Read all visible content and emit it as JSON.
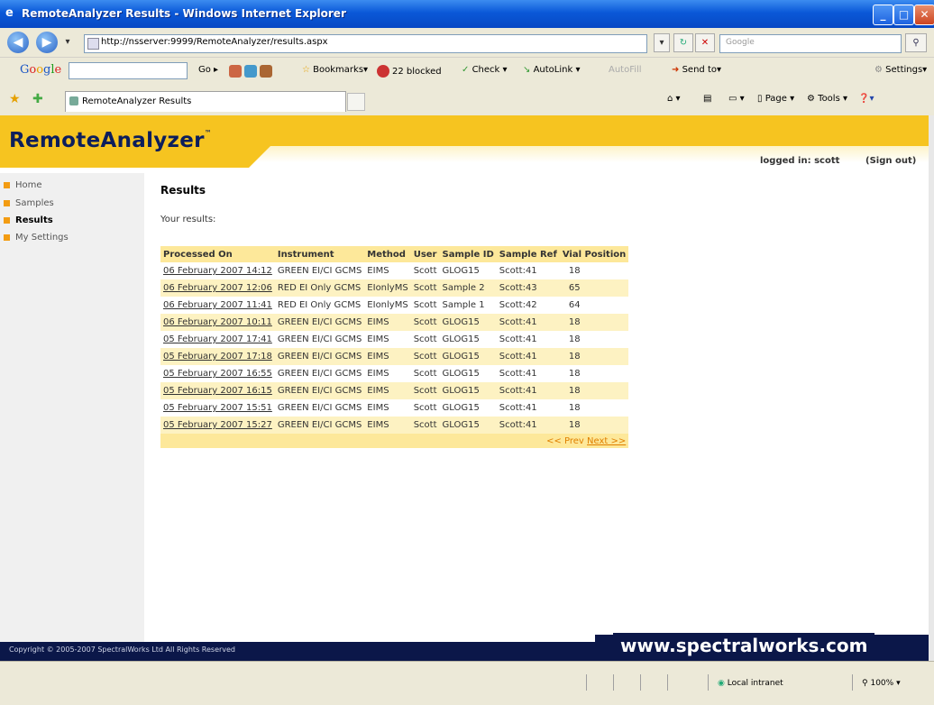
{
  "window": {
    "title": "RemoteAnalyzer Results - Windows Internet Explorer"
  },
  "address": {
    "url": "http://nsserver:9999/RemoteAnalyzer/results.aspx",
    "search_placeholder": "Google"
  },
  "gtoolbar": {
    "go": "Go",
    "bookmarks": "Bookmarks",
    "blocked": "22 blocked",
    "check": "Check",
    "autolink": "AutoLink",
    "autofill": "AutoFill",
    "sendto": "Send to",
    "settings": "Settings"
  },
  "tab": {
    "label": "RemoteAnalyzer Results"
  },
  "cmdbar": {
    "page": "Page",
    "tools": "Tools"
  },
  "site": {
    "logo": "RemoteAnalyzer",
    "tm": "™",
    "login": "logged in: scott",
    "signout": "(Sign out)",
    "nav": [
      "Home",
      "Samples",
      "Results",
      "My Settings"
    ],
    "page_title": "Results",
    "intro": "Your results:",
    "footer_copy": "Copyright © 2005-2007 SpectralWorks Ltd  All Rights Reserved",
    "footer_site": "www.spectralworks.com"
  },
  "table": {
    "headers": [
      "Processed On",
      "Instrument",
      "Method",
      "User",
      "Sample ID",
      "Sample Ref",
      "Vial Position"
    ],
    "rows": [
      [
        "06 February 2007 14:12",
        "GREEN EI/CI GCMS",
        "EIMS",
        "Scott",
        "GLOG15",
        "Scott:41",
        "18"
      ],
      [
        "06 February 2007 12:06",
        "RED EI Only GCMS",
        "EIonlyMS",
        "Scott",
        "Sample 2",
        "Scott:43",
        "65"
      ],
      [
        "06 February 2007 11:41",
        "RED EI Only GCMS",
        "EIonlyMS",
        "Scott",
        "Sample 1",
        "Scott:42",
        "64"
      ],
      [
        "06 February 2007 10:11",
        "GREEN EI/CI GCMS",
        "EIMS",
        "Scott",
        "GLOG15",
        "Scott:41",
        "18"
      ],
      [
        "05 February 2007 17:41",
        "GREEN EI/CI GCMS",
        "EIMS",
        "Scott",
        "GLOG15",
        "Scott:41",
        "18"
      ],
      [
        "05 February 2007 17:18",
        "GREEN EI/CI GCMS",
        "EIMS",
        "Scott",
        "GLOG15",
        "Scott:41",
        "18"
      ],
      [
        "05 February 2007 16:55",
        "GREEN EI/CI GCMS",
        "EIMS",
        "Scott",
        "GLOG15",
        "Scott:41",
        "18"
      ],
      [
        "05 February 2007 16:15",
        "GREEN EI/CI GCMS",
        "EIMS",
        "Scott",
        "GLOG15",
        "Scott:41",
        "18"
      ],
      [
        "05 February 2007 15:51",
        "GREEN EI/CI GCMS",
        "EIMS",
        "Scott",
        "GLOG15",
        "Scott:41",
        "18"
      ],
      [
        "05 February 2007 15:27",
        "GREEN EI/CI GCMS",
        "EIMS",
        "Scott",
        "GLOG15",
        "Scott:41",
        "18"
      ]
    ],
    "prev": "<< Prev",
    "next": "Next >>"
  },
  "status": {
    "zone": "Local intranet",
    "zoom": "100%"
  }
}
